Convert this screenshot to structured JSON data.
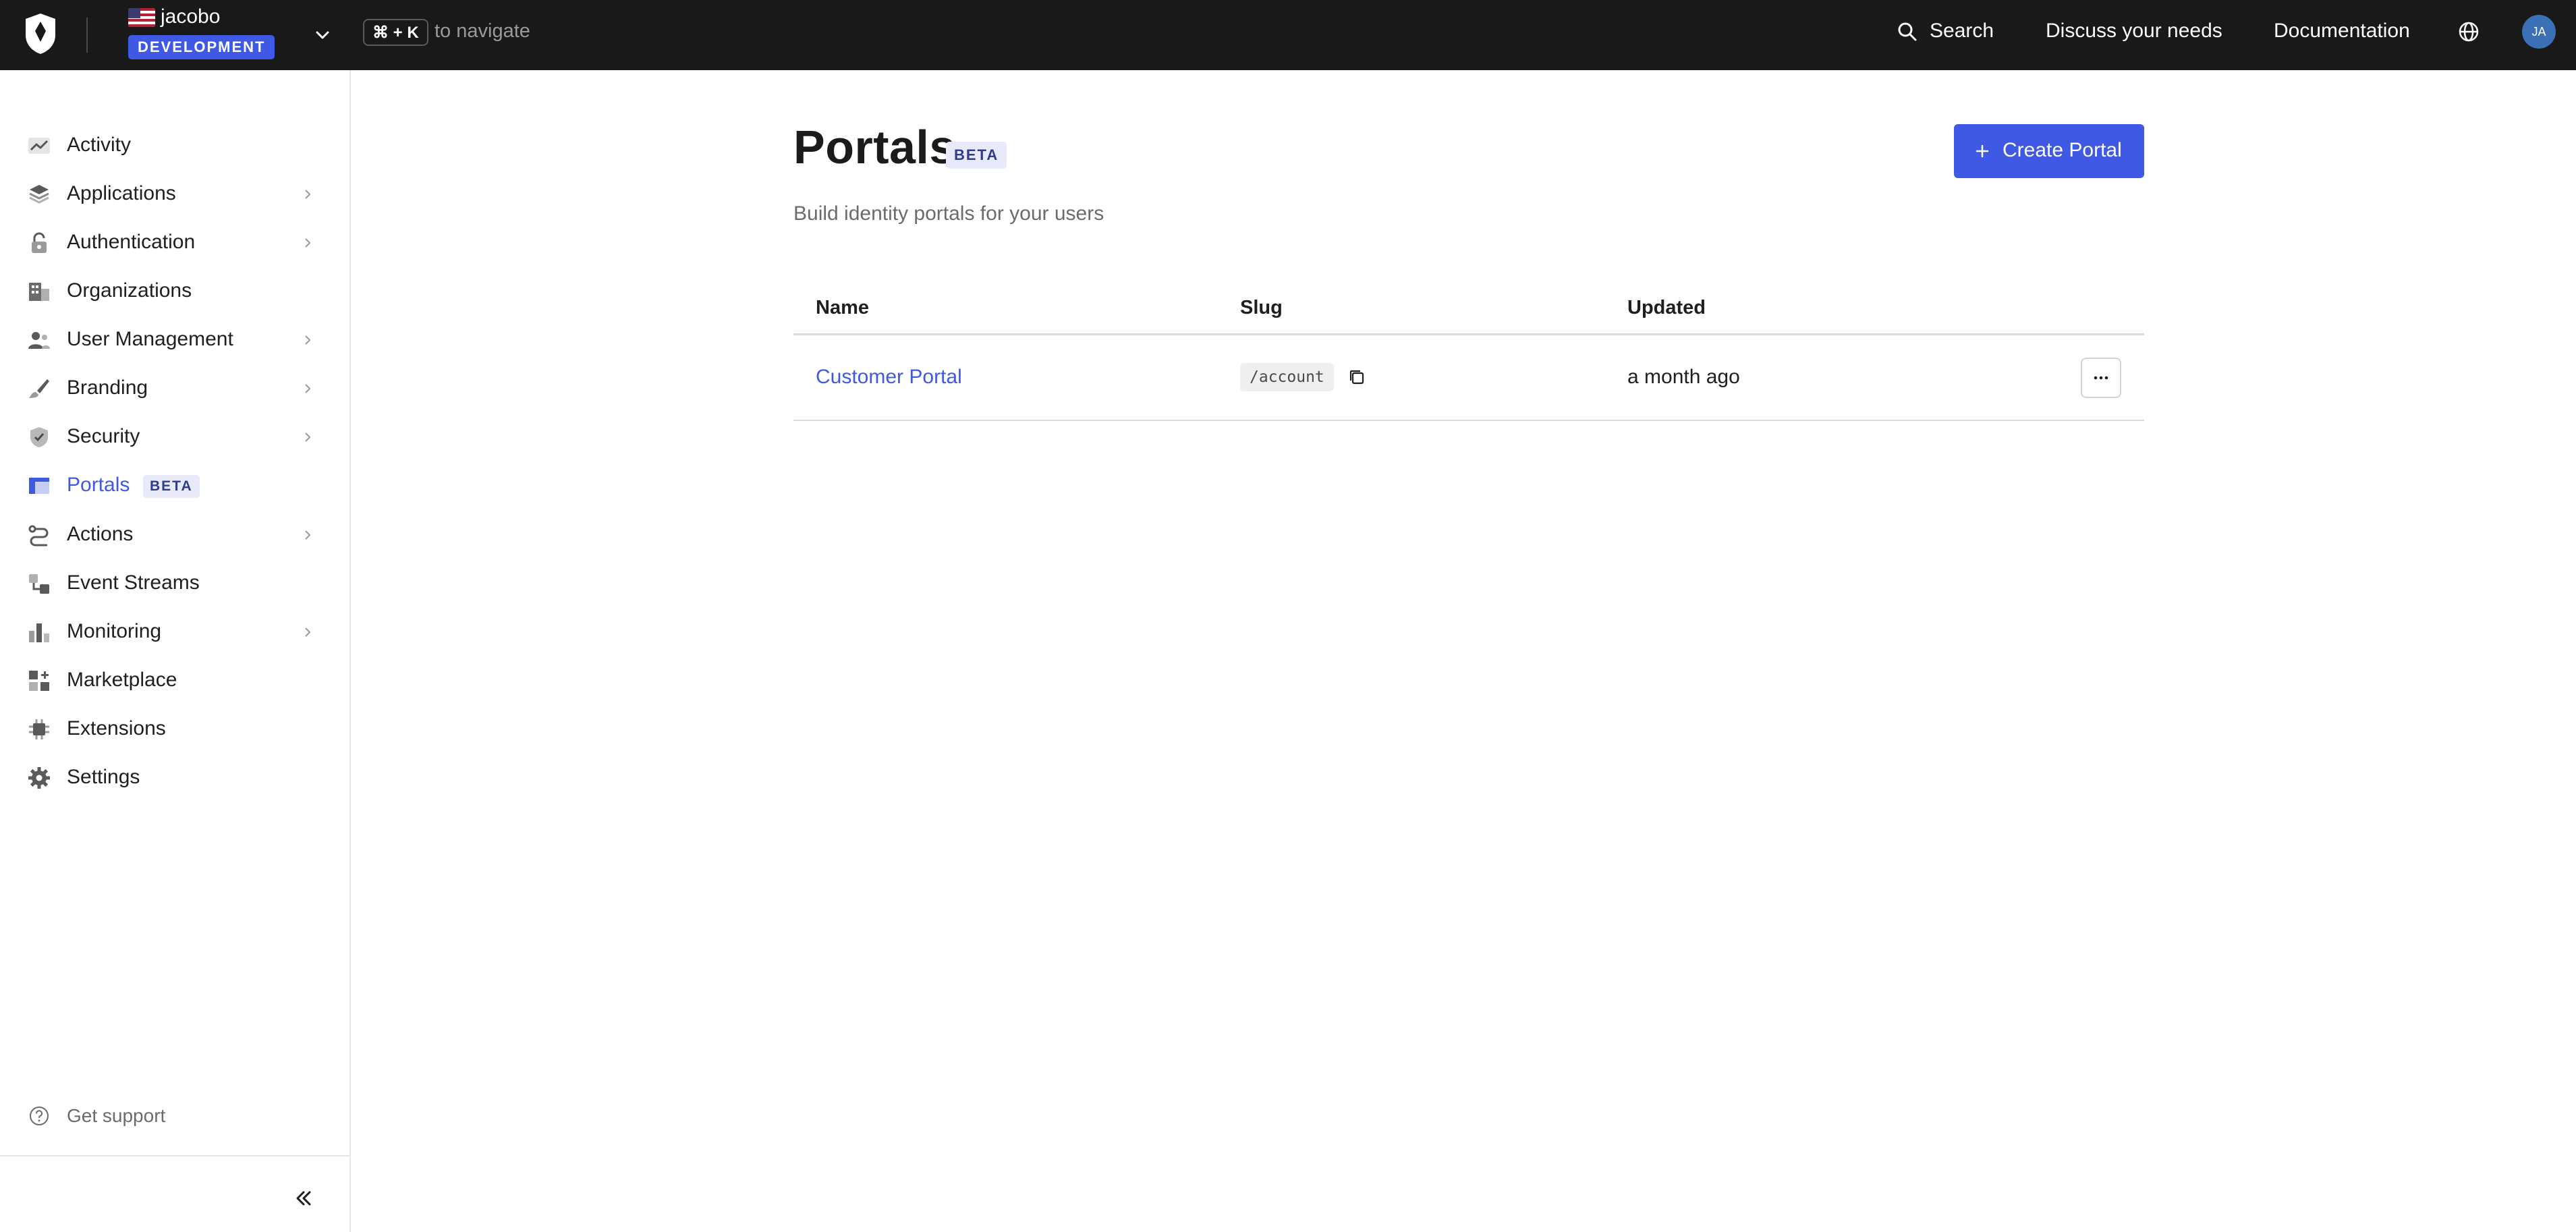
{
  "topbar": {
    "tenant_name": "jacobo",
    "environment": "DEVELOPMENT",
    "shortcut": "⌘ + K",
    "shortcut_hint": "to navigate",
    "search_label": "Search",
    "discuss_label": "Discuss your needs",
    "docs_label": "Documentation",
    "avatar_initials": "JA"
  },
  "sidebar": {
    "items": [
      {
        "label": "Activity",
        "icon": "activity-icon"
      },
      {
        "label": "Applications",
        "icon": "applications-icon",
        "has_children": true
      },
      {
        "label": "Authentication",
        "icon": "lock-icon",
        "has_children": true
      },
      {
        "label": "Organizations",
        "icon": "building-icon"
      },
      {
        "label": "User Management",
        "icon": "users-icon",
        "has_children": true
      },
      {
        "label": "Branding",
        "icon": "brush-icon",
        "has_children": true
      },
      {
        "label": "Security",
        "icon": "shield-icon",
        "has_children": true
      },
      {
        "label": "Portals",
        "icon": "portal-icon",
        "active": true,
        "badge": "BETA"
      },
      {
        "label": "Actions",
        "icon": "actions-icon",
        "has_children": true
      },
      {
        "label": "Event Streams",
        "icon": "event-streams-icon"
      },
      {
        "label": "Monitoring",
        "icon": "bar-chart-icon",
        "has_children": true
      },
      {
        "label": "Marketplace",
        "icon": "marketplace-icon"
      },
      {
        "label": "Extensions",
        "icon": "puzzle-icon"
      },
      {
        "label": "Settings",
        "icon": "gear-icon"
      }
    ],
    "support_label": "Get support"
  },
  "main": {
    "title": "Portals",
    "title_badge": "BETA",
    "subtitle": "Build identity portals for your users",
    "create_button": "Create Portal",
    "table": {
      "columns": [
        "Name",
        "Slug",
        "Updated"
      ],
      "rows": [
        {
          "name": "Customer Portal",
          "slug": "/account",
          "updated": "a month ago"
        }
      ]
    }
  },
  "colors": {
    "accent": "#3f59e4",
    "topbar_bg": "#191919",
    "badge_bg": "#e8eaf9",
    "badge_text": "#2f3c8d"
  }
}
